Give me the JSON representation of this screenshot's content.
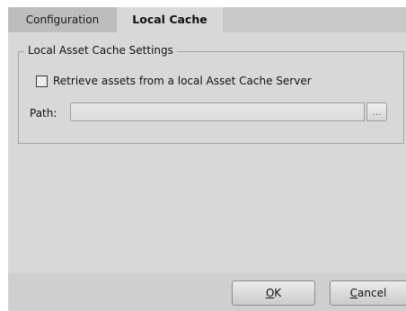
{
  "tabs": [
    {
      "label": "Configuration",
      "active": false
    },
    {
      "label": "Local Cache",
      "active": true
    }
  ],
  "group": {
    "title": "Local Asset Cache Settings",
    "checkbox_label": "Retrieve assets from a local Asset Cache Server",
    "checkbox_checked": false,
    "path_label": "Path:",
    "path_value": "",
    "browse_label": "..."
  },
  "buttons": {
    "ok": {
      "mnemonic": "O",
      "rest": "K"
    },
    "cancel": {
      "mnemonic": "C",
      "rest": "ancel"
    }
  },
  "colors": {
    "panel": "#d8d8d8",
    "tab_inactive": "#bdbdbd",
    "border": "#a5a5a5"
  }
}
